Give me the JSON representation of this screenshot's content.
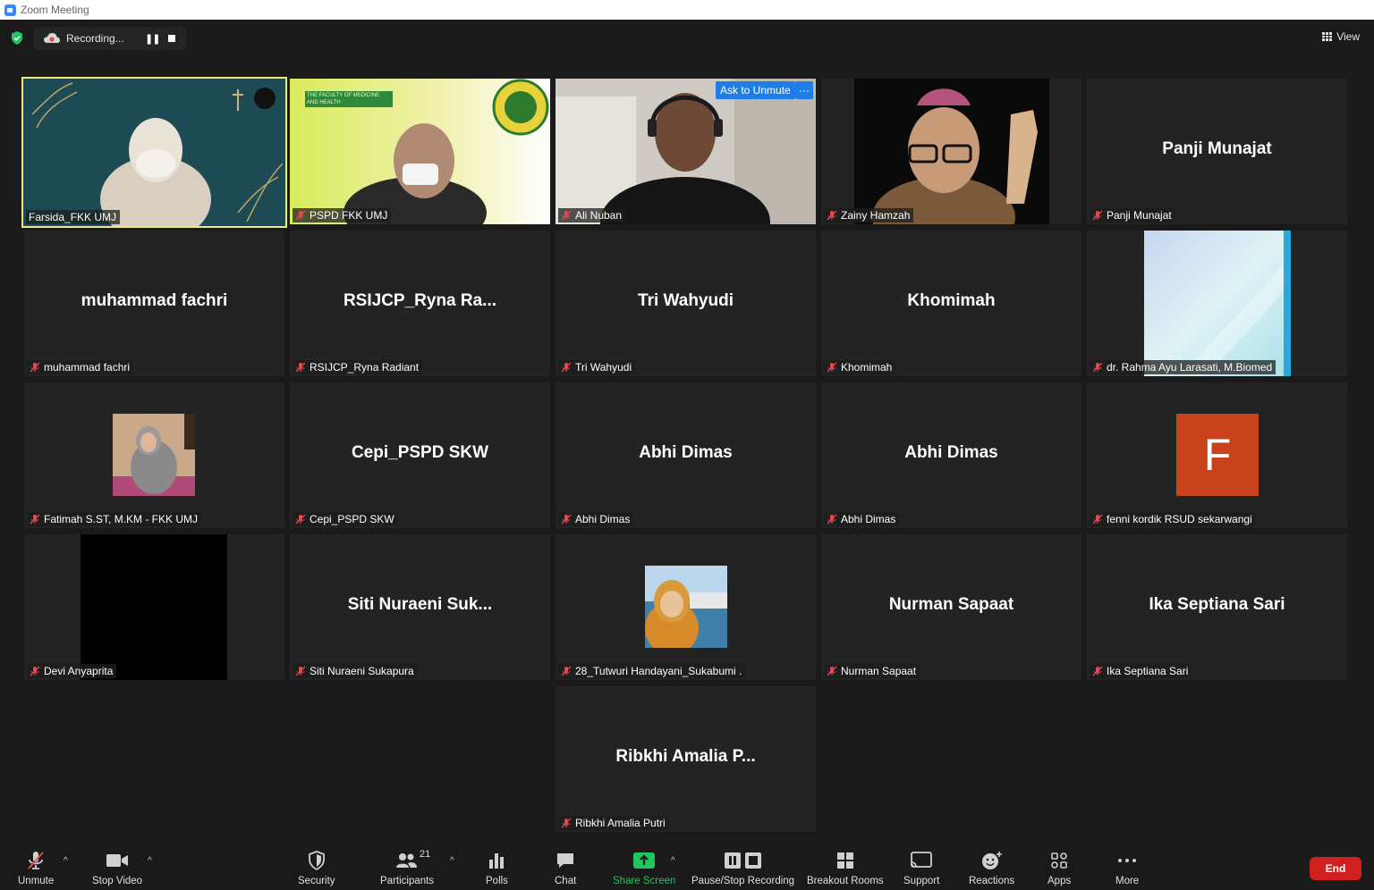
{
  "window": {
    "title": "Zoom Meeting"
  },
  "topbar": {
    "recording_text": "Recording...",
    "view_label": "View"
  },
  "tiles": [
    {
      "display_name": "",
      "label": "Farsida_FKK UMJ"
    },
    {
      "display_name": "",
      "label": "PSPD FKK UMJ"
    },
    {
      "display_name": "",
      "label": "Ali Nuban"
    },
    {
      "display_name": "",
      "label": "Zainy Hamzah"
    },
    {
      "display_name": "Panji Munajat",
      "label": "Panji Munajat"
    },
    {
      "display_name": "muhammad fachri",
      "label": "muhammad fachri"
    },
    {
      "display_name": "RSIJCP_Ryna  Ra...",
      "label": "RSIJCP_Ryna Radiant"
    },
    {
      "display_name": "Tri Wahyudi",
      "label": "Tri Wahyudi"
    },
    {
      "display_name": "Khomimah",
      "label": "Khomimah"
    },
    {
      "display_name": "",
      "label": "dr. Rahma Ayu Larasati, M.Biomed"
    },
    {
      "display_name": "",
      "label": "Fatimah S.ST, M.KM - FKK UMJ"
    },
    {
      "display_name": "Cepi_PSPD SKW",
      "label": "Cepi_PSPD SKW"
    },
    {
      "display_name": "Abhi Dimas",
      "label": "Abhi Dimas"
    },
    {
      "display_name": "Abhi Dimas",
      "label": "Abhi Dimas"
    },
    {
      "display_name": "",
      "label": "fenni kordik RSUD sekarwangi",
      "avatar_letter": "F"
    },
    {
      "display_name": "",
      "label": "Devi Anyaprita"
    },
    {
      "display_name": "Siti  Nuraeni  Suk...",
      "label": "Siti Nuraeni Sukapura"
    },
    {
      "display_name": "",
      "label": "28_Tutwuri Handayani_Sukabumi ."
    },
    {
      "display_name": "Nurman Sapaat",
      "label": "Nurman Sapaat"
    },
    {
      "display_name": "Ika Septiana Sari",
      "label": "Ika Septiana Sari"
    },
    {
      "display_name": "Ribkhi  Amalia  P...",
      "label": "Ribkhi Amalia Putri"
    }
  ],
  "overlay": {
    "ask_to_unmute": "Ask to Unmute",
    "more": "···"
  },
  "video_logo_text": "THE FACULTY OF MEDICINE AND HEALTH",
  "toolbar": {
    "unmute": "Unmute",
    "stop_video": "Stop Video",
    "security": "Security",
    "participants": "Participants",
    "participant_count": "21",
    "polls": "Polls",
    "chat": "Chat",
    "share_screen": "Share Screen",
    "pause_stop_recording": "Pause/Stop Recording",
    "breakout_rooms": "Breakout Rooms",
    "support": "Support",
    "reactions": "Reactions",
    "apps": "Apps",
    "more": "More",
    "end": "End"
  },
  "colors": {
    "accent_blue": "#1f7de8",
    "share_green": "#22c55e",
    "end_red": "#d02020",
    "active_speaker": "#f0ea79",
    "mic_off_red": "#e5484d",
    "avatar_orange": "#c8431c"
  }
}
